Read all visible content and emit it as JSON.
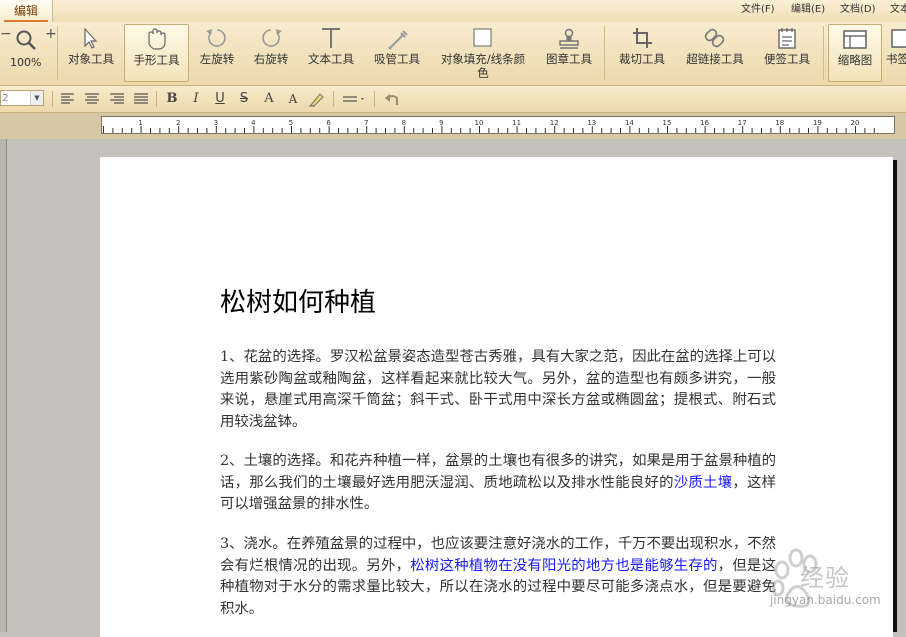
{
  "tab": {
    "label": "编辑"
  },
  "menus": [
    "文件(F)",
    "编辑(E)",
    "文档(D)",
    "文本"
  ],
  "zoom": {
    "minus": "−",
    "plus": "+",
    "value": "100%"
  },
  "tools": [
    {
      "label": "对象工具",
      "icon": "pointer-icon"
    },
    {
      "label": "手形工具",
      "icon": "hand-icon"
    },
    {
      "label": "左旋转",
      "icon": "rotate-left-icon"
    },
    {
      "label": "右旋转",
      "icon": "rotate-right-icon"
    },
    {
      "label": "文本工具",
      "icon": "text-icon"
    },
    {
      "label": "吸管工具",
      "icon": "eyedropper-icon"
    },
    {
      "label": "对象填充/线条颜",
      "label2": "色",
      "icon": "fill-color-icon"
    },
    {
      "label": "图章工具",
      "icon": "stamp-icon"
    },
    {
      "label": "裁切工具",
      "icon": "crop-icon"
    },
    {
      "label": "超链接工具",
      "icon": "link-icon"
    },
    {
      "label": "便签工具",
      "icon": "note-icon"
    },
    {
      "label": "缩略图",
      "icon": "thumbnail-icon"
    },
    {
      "label": "书签",
      "icon": "bookmark-icon"
    }
  ],
  "format": {
    "font_size": "2",
    "buttons": [
      "≡",
      "≡",
      "≡",
      "≡",
      "B",
      "I",
      "U",
      "S",
      "A",
      "A",
      "",
      "≡",
      "↶"
    ]
  },
  "ruler": {
    "labels": [
      "1",
      "2",
      "3",
      "4",
      "5",
      "6",
      "7",
      "8",
      "9",
      "10",
      "11",
      "12",
      "13",
      "14",
      "15",
      "16",
      "17",
      "18",
      "19",
      "20"
    ]
  },
  "document": {
    "title": "松树如何种植",
    "p1": "1、花盆的选择。罗汉松盆景姿态造型苍古秀雅，具有大家之范，因此在盆的选择上可以选用紫砂陶盆或釉陶盆，这样看起来就比较大气。另外，盆的造型也有颇多讲究，一般来说，悬崖式用高深千筒盆；斜干式、卧干式用中深长方盆或椭圆盆；提根式、附石式用较浅盆钵。",
    "p2a": "2、土壤的选择。和花卉种植一样，盆景的土壤也有很多的讲究，如果是用于盆景种植的话，那么我们的土壤最好选用肥沃湿润、质地疏松以及排水性能良好的",
    "p2link": "沙质土壤",
    "p2b": "，这样可以增强盆景的排水性。",
    "p3a": "3、浇水。在养殖盆景的过程中，也应该要注意好浇水的工作，千万不要出现积水，不然会有烂根情况的出现。另外，",
    "p3link": "松树这种植物在没有阳光的地方也是能够生存的",
    "p3b": "，但是这种植物对于水分的需求量比较大，所以在浇水的过程中要尽可能多浇点水，但是要避免积水。"
  },
  "watermark": {
    "text": "经验",
    "url": "jingyan.baidu.com"
  }
}
